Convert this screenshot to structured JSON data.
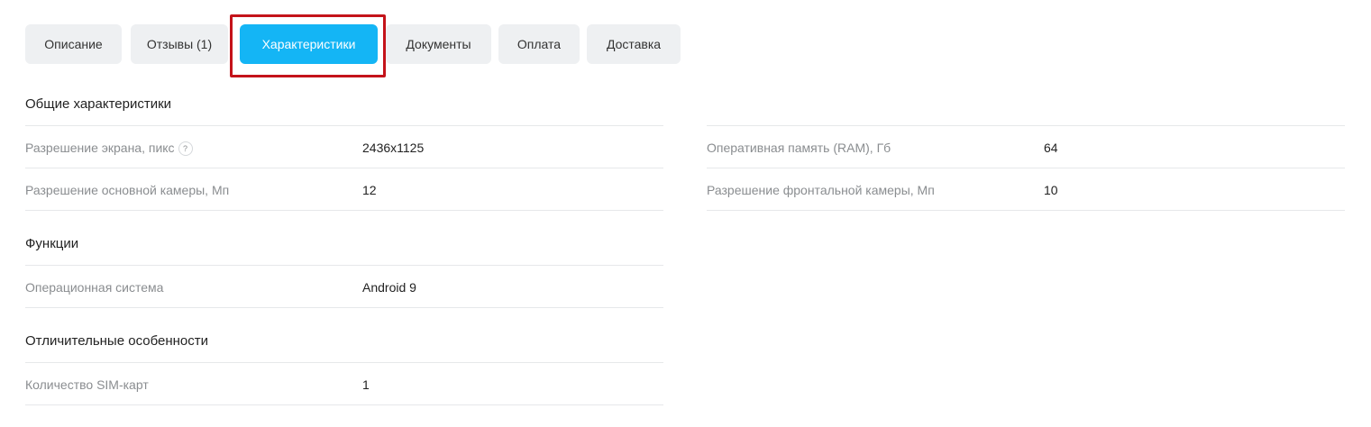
{
  "tabs": [
    {
      "label": "Описание",
      "active": false
    },
    {
      "label": "Отзывы (1)",
      "active": false
    },
    {
      "label": "Характеристики",
      "active": true
    },
    {
      "label": "Документы",
      "active": false
    },
    {
      "label": "Оплата",
      "active": false
    },
    {
      "label": "Доставка",
      "active": false
    }
  ],
  "colors": {
    "active_tab": "#14b5f5",
    "inactive_tab": "#eef0f2",
    "highlight": "#c4131a"
  },
  "sections": {
    "general": {
      "title": "Общие характеристики",
      "rows": [
        {
          "label": "Разрешение экрана, пикс",
          "value": "2436x1125",
          "help_icon": "?"
        },
        {
          "label": "Разрешение основной камеры, Мп",
          "value": "12"
        }
      ],
      "right_rows": [
        {
          "label": "Оперативная память (RAM), Гб",
          "value": "64"
        },
        {
          "label": "Разрешение фронтальной камеры, Мп",
          "value": "10"
        }
      ]
    },
    "functions": {
      "title": "Функции",
      "rows": [
        {
          "label": "Операционная система",
          "value": "Android 9"
        }
      ]
    },
    "features": {
      "title": "Отличительные особенности",
      "rows": [
        {
          "label": "Количество SIM-карт",
          "value": "1"
        }
      ]
    }
  }
}
